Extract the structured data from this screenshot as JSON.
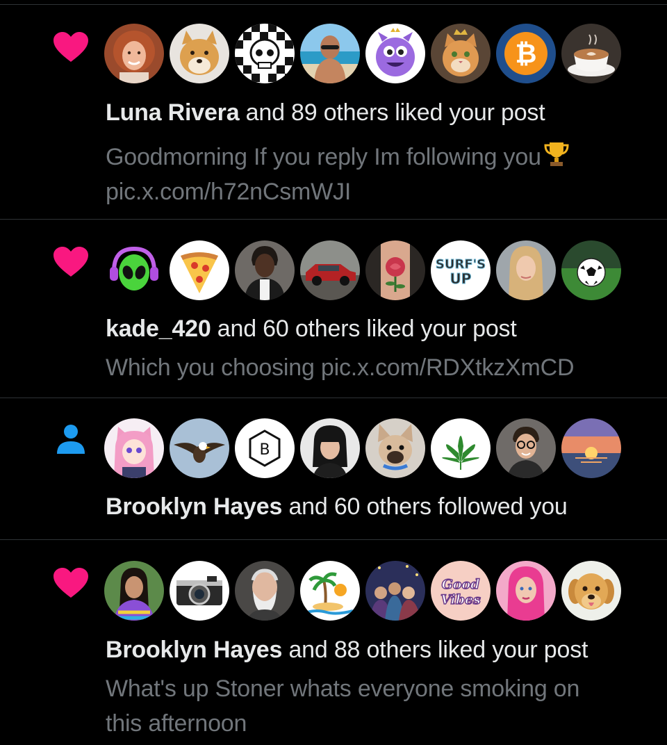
{
  "colors": {
    "background": "#000000",
    "divider": "#2f3336",
    "primary_text": "#e7e9ea",
    "secondary_text": "#71767b",
    "like_heart": "#f91880",
    "follow_icon": "#1d9bf0"
  },
  "notifications": [
    {
      "type": "like",
      "icon": "heart-icon",
      "avatars": [
        "redhead-woman",
        "shiba-dog",
        "checker-skull",
        "beach-man",
        "purple-monster",
        "crowned-cat",
        "bitcoin-logo",
        "latte-cup"
      ],
      "actor": "Luna Rivera",
      "action": "and 89 others liked your post",
      "preview_line1": "Goodmorning If you reply Im following you",
      "preview_emoji": "trophy-icon",
      "preview_line2": "pic.x.com/h72nCsmWJI"
    },
    {
      "type": "like",
      "icon": "heart-icon",
      "avatars": [
        "alien-headphones",
        "pizza-slice",
        "man-leather-jacket",
        "red-classic-car",
        "rose-tattoo",
        "surfs-up-logo",
        "blonde-woman",
        "soccer-ball"
      ],
      "actor": "kade_420",
      "action": "and 60 others liked your post",
      "preview_line1": "Which you choosing pic.x.com/RDXtkzXmCD"
    },
    {
      "type": "follow",
      "icon": "person-icon",
      "avatars": [
        "anime-catgirl",
        "bald-eagle",
        "hexagon-b-logo",
        "dark-hair-woman",
        "french-bulldog",
        "cannabis-leaf",
        "man-glasses",
        "sunset-sea"
      ],
      "actor": "Brooklyn Hayes",
      "action": "and 60 others followed you"
    },
    {
      "type": "like",
      "icon": "heart-icon",
      "avatars": [
        "woman-tie-dye",
        "vintage-camera",
        "old-man-beard",
        "palm-island",
        "group-friends",
        "good-vibes-logo",
        "pink-hair-woman",
        "golden-retriever"
      ],
      "actor": "Brooklyn Hayes",
      "action": "and 88 others liked your post",
      "preview_line1": "What's up Stoner whats everyone smoking on",
      "preview_line2": "this afternoon"
    }
  ]
}
